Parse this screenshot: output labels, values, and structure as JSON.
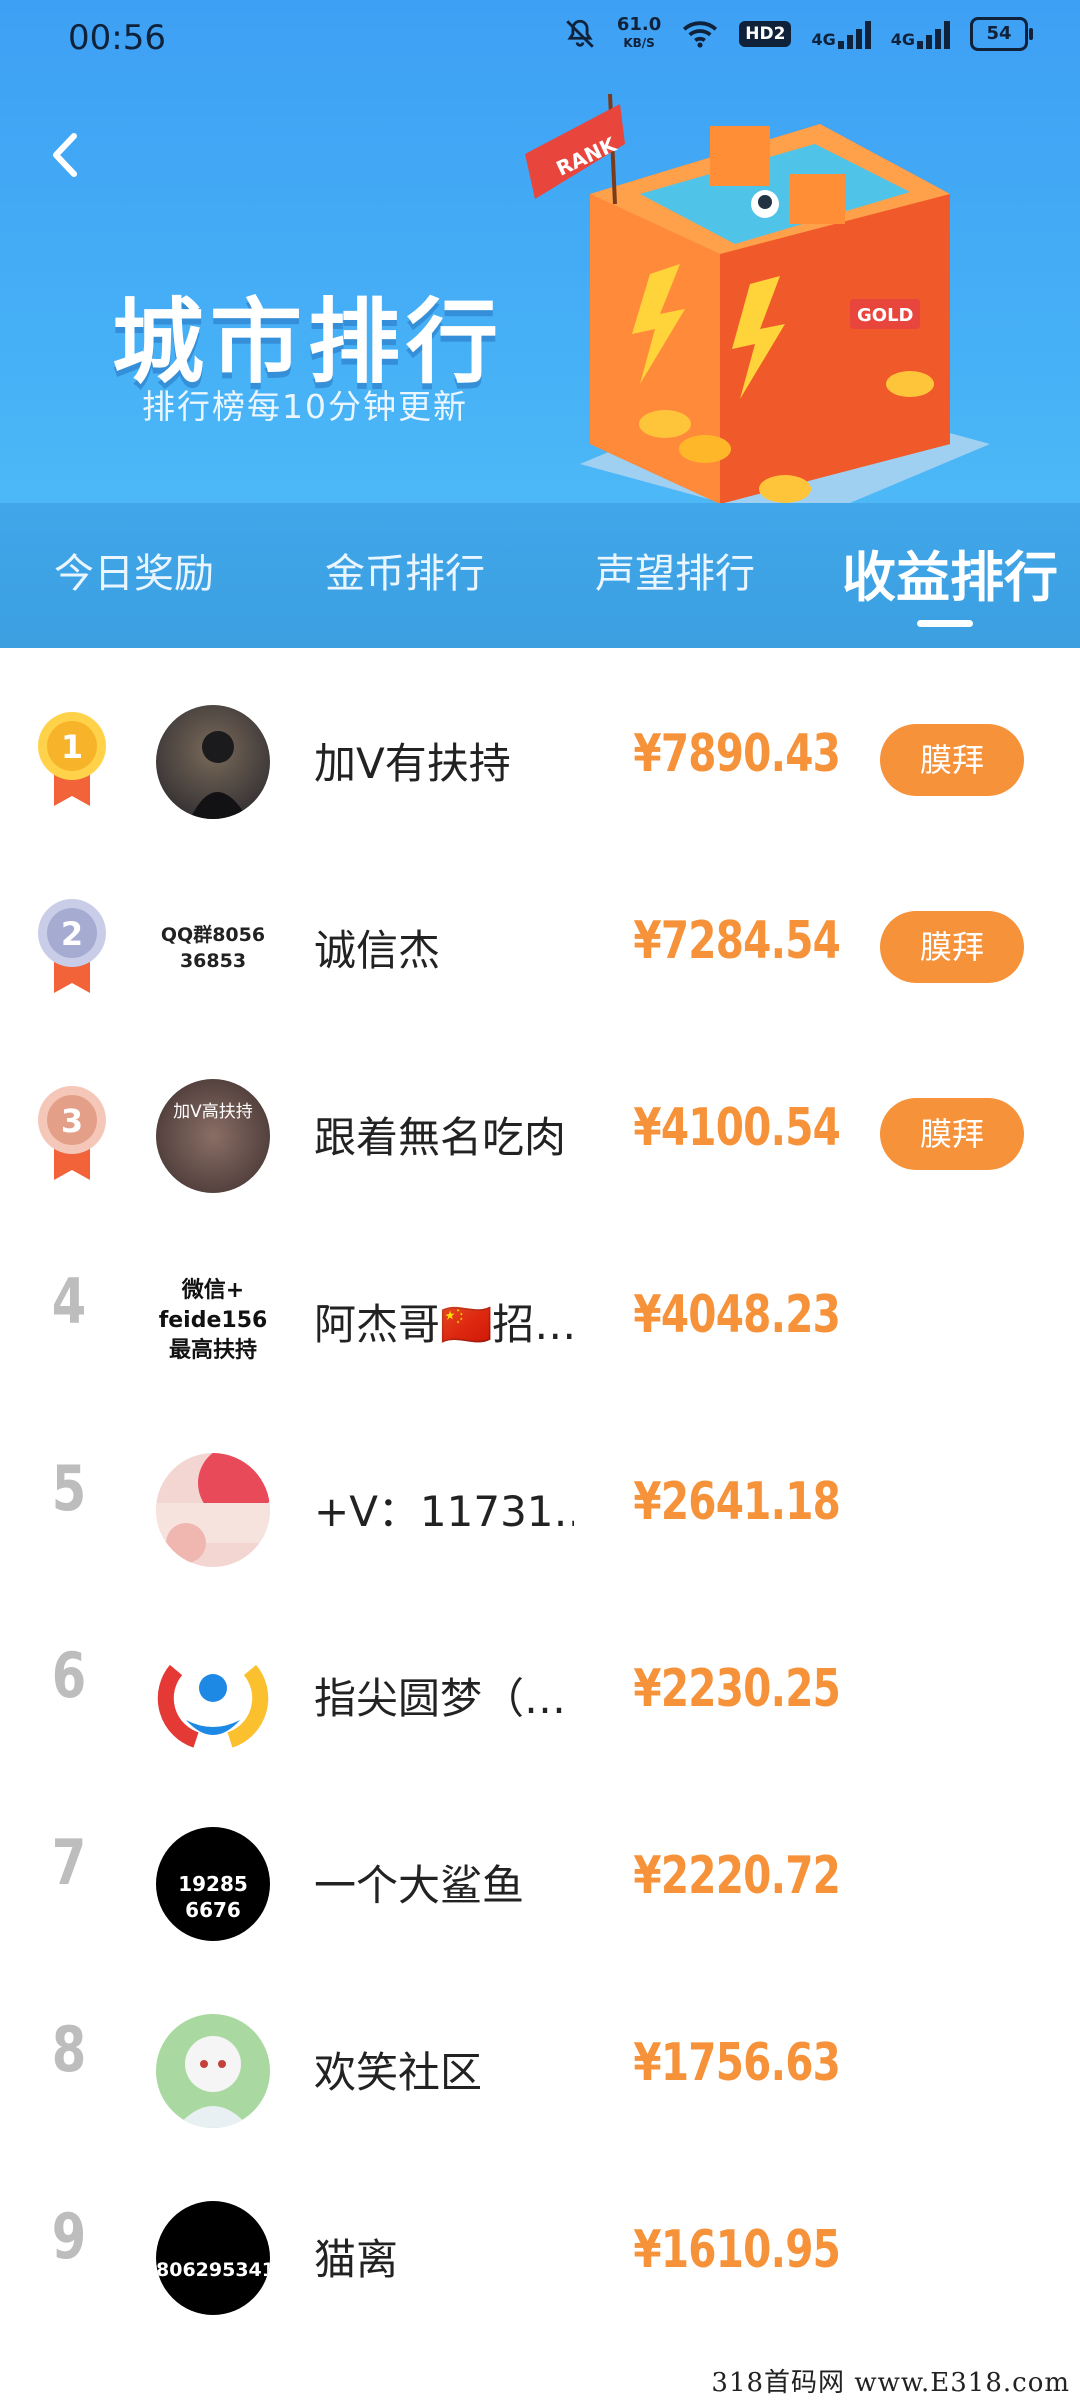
{
  "status_bar": {
    "time": "00:56",
    "net_speed_value": "61.0",
    "net_speed_unit": "KB/S",
    "hd_label": "HD2",
    "signal1": "4G",
    "signal2": "4G",
    "battery": "54"
  },
  "header": {
    "title": "城市排行",
    "subtitle": "排行榜每10分钟更新",
    "flag_text": "RANK",
    "gold_text": "GOLD"
  },
  "tabs": [
    {
      "label": "今日奖励",
      "active": false
    },
    {
      "label": "金币排行",
      "active": false
    },
    {
      "label": "声望排行",
      "active": false
    },
    {
      "label": "收益排行",
      "active": true
    }
  ],
  "rankings": [
    {
      "rank": "1",
      "name": "加V有扶持",
      "amount": "¥7890.43",
      "button": "膜拜",
      "avatar_text": ""
    },
    {
      "rank": "2",
      "name": "诚信杰",
      "amount": "¥7284.54",
      "button": "膜拜",
      "avatar_text": "QQ群8056 36853"
    },
    {
      "rank": "3",
      "name": "跟着無名吃肉",
      "amount": "¥4100.54",
      "button": "膜拜",
      "avatar_text": "加V高扶持"
    },
    {
      "rank": "4",
      "name": "阿杰哥🇨🇳招…",
      "amount": "¥4048.23",
      "button": "",
      "avatar_text": "微信+ feide156 最高扶持"
    },
    {
      "rank": "5",
      "name": "+V：11731…",
      "amount": "¥2641.18",
      "button": "",
      "avatar_text": ""
    },
    {
      "rank": "6",
      "name": "指尖圆梦（…",
      "amount": "¥2230.25",
      "button": "",
      "avatar_text": ""
    },
    {
      "rank": "7",
      "name": "一个大鲨鱼",
      "amount": "¥2220.72",
      "button": "",
      "avatar_text": "19285 6676"
    },
    {
      "rank": "8",
      "name": "欢笑社区",
      "amount": "¥1756.63",
      "button": "",
      "avatar_text": ""
    },
    {
      "rank": "9",
      "name": "猫离",
      "amount": "¥1610.95",
      "button": "",
      "avatar_text": "806295341"
    }
  ],
  "watermark": "318首码网 www.E318.com",
  "colors": {
    "header_blue": "#3ea0f4",
    "tabs_blue": "#3b9fe0",
    "accent_orange": "#f5923a",
    "rank_gray": "#bdbdbd"
  }
}
